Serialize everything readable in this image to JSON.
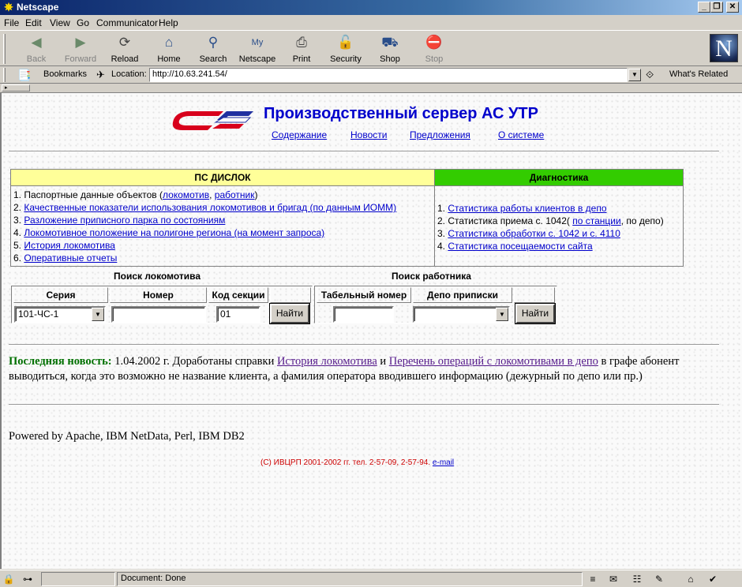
{
  "window": {
    "title": "Netscape"
  },
  "menu": [
    "File",
    "Edit",
    "View",
    "Go",
    "Communicator",
    "Help"
  ],
  "toolbar": {
    "buttons": [
      {
        "label": "Back",
        "icon": "back-arrow-icon",
        "enabled": false
      },
      {
        "label": "Forward",
        "icon": "forward-arrow-icon",
        "enabled": false
      },
      {
        "label": "Reload",
        "icon": "reload-icon",
        "enabled": true
      },
      {
        "label": "Home",
        "icon": "home-icon",
        "enabled": true
      },
      {
        "label": "Search",
        "icon": "search-icon",
        "enabled": true
      },
      {
        "label": "Netscape",
        "icon": "netscape-icon",
        "enabled": true
      },
      {
        "label": "Print",
        "icon": "print-icon",
        "enabled": true
      },
      {
        "label": "Security",
        "icon": "lock-icon",
        "enabled": true
      },
      {
        "label": "Shop",
        "icon": "shop-icon",
        "enabled": true
      },
      {
        "label": "Stop",
        "icon": "stop-icon",
        "enabled": false
      }
    ]
  },
  "location": {
    "bookmarks_label": "Bookmarks",
    "location_label": "Location:",
    "url": "http://10.63.241.54/",
    "whats_related": "What's Related"
  },
  "page": {
    "title": "Производственный сервер АС УТР",
    "nav": [
      "Содержание",
      "Новости",
      "Предложения",
      "О системе"
    ],
    "dislok": {
      "header": "ПС ДИСЛОК",
      "items": [
        {
          "num": "1.",
          "pre": "Паспортные данные объектов (",
          "link1": "локомотив",
          "mid": ", ",
          "link2": "работник",
          "post": ")"
        },
        {
          "num": "2.",
          "link": "Качественные показатели использования локомотивов и бригад (по данным ИОММ)"
        },
        {
          "num": "3.",
          "link": "Разложение приписного парка по состояниям "
        },
        {
          "num": "4.",
          "link": "Локомотивное положение на полигоне региона (на момент запроса)"
        },
        {
          "num": "5.",
          "link": "История локомотива "
        },
        {
          "num": "6.",
          "link": "Оперативные отчеты "
        }
      ]
    },
    "diag": {
      "header": "Диагностика",
      "items": [
        {
          "num": "1.",
          "link": "Статистика работы клиентов в депо"
        },
        {
          "num": "2.",
          "pre": "Статистика приема с. 1042( ",
          "link": "по станции",
          "post": ", по депо)"
        },
        {
          "num": "3.",
          "link": "Статистика обработки с. 1042 и с. 4110"
        },
        {
          "num": "4.",
          "link": "Статистика посещаемости сайта"
        }
      ]
    },
    "loco_search": {
      "title": "Поиск локомотива",
      "col_series": "Серия",
      "col_number": "Номер",
      "col_section": "Код секции",
      "series_value": "101-ЧС-1",
      "number_value": "",
      "section_value": "01",
      "button": "Найти"
    },
    "worker_search": {
      "title": "Поиск работника",
      "col_tabnum": "Табельный номер",
      "col_depot": "Депо приписки",
      "tabnum_value": "",
      "depot_value": "",
      "button": "Найти"
    },
    "news": {
      "label": "Последняя новость:",
      "date_text": " 1.04.2002 г. Доработаны справки ",
      "link1": "История локомотива",
      "and": " и ",
      "link2": "Перечень операций с локомотивами в депо",
      "rest": " в графе абонент выводиться, когда это возможно не название клиента, а фамилия оператора вводившего информацию (дежурный по депо или пр.)"
    },
    "powered": "Powered by Apache, IBM NetData, Perl, IBM DB2",
    "copyright": "(C) ИВЦРП 2001-2002 гг. тел. 2-57-09, 2-57-94. ",
    "email": "e-mail"
  },
  "status": {
    "text": "Document: Done"
  },
  "colors": {
    "dislok_header": "#ffff99",
    "diag_header": "#33cc00",
    "link": "#0000cc",
    "visited": "#551a8b",
    "news_label": "#007000"
  }
}
